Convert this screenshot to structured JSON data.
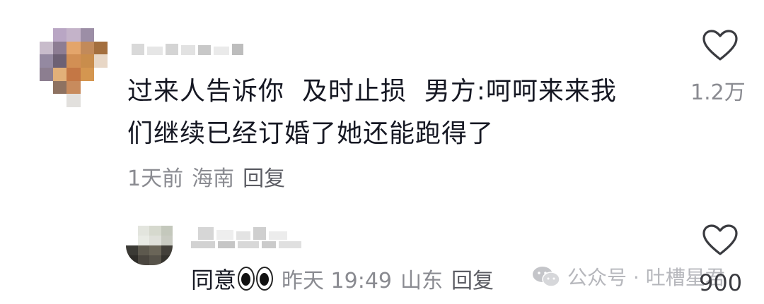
{
  "comments": [
    {
      "text_line1": "过来人告诉你  及时止损  男方:呵呵来来我",
      "text_line2": "们继续已经订婚了她还能跑得了",
      "time": "1天前",
      "location": "海南",
      "reply_label": "回复",
      "like_count": "1.2万",
      "like_icon": "heart-outline-icon"
    },
    {
      "text_prefix": "同意",
      "emoji": "eyes-emoji",
      "time": "昨天 19:49",
      "location": "山东",
      "reply_label": "回复",
      "like_count": "900",
      "like_icon": "heart-outline-icon"
    }
  ],
  "watermark": {
    "icon": "wechat-icon",
    "text": "公众号 · 吐槽星君"
  },
  "colors": {
    "text": "#161823",
    "meta": "#8a8b91",
    "watermark": "#b6b7bc"
  }
}
